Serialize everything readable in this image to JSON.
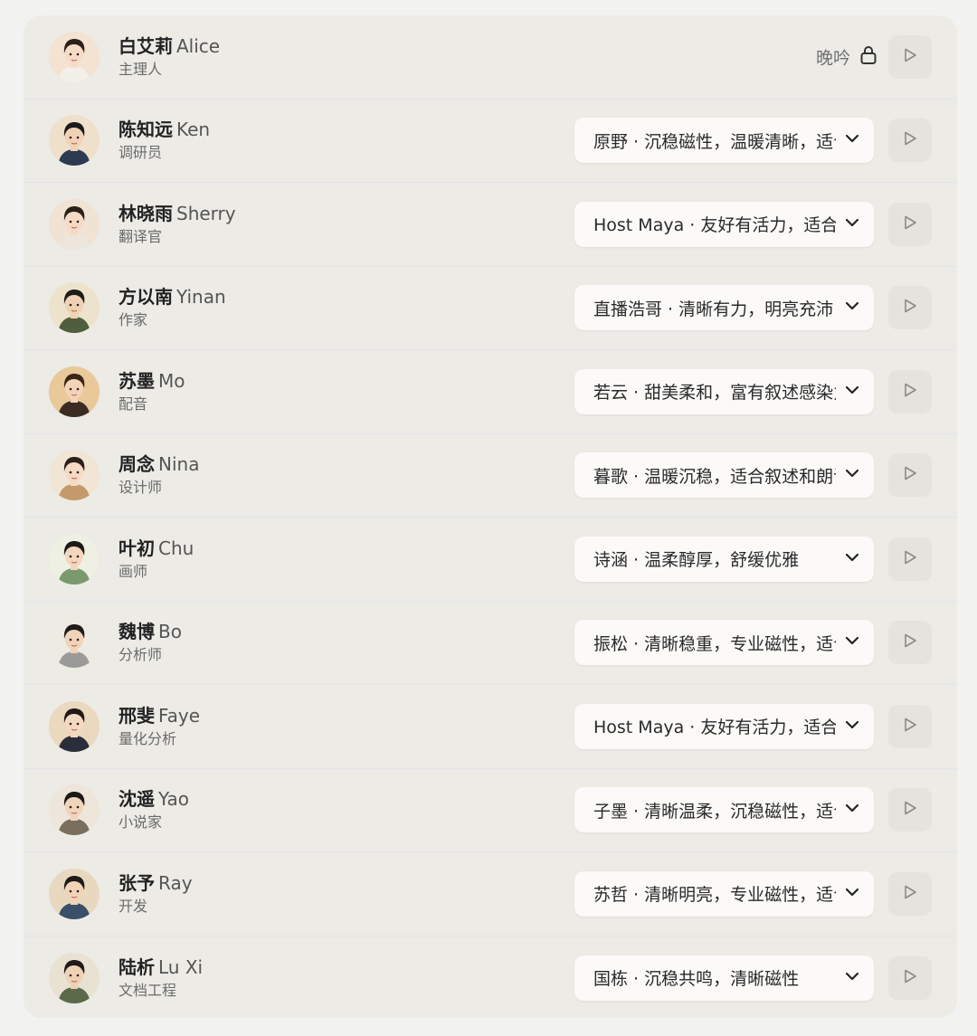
{
  "members": [
    {
      "name_zh": "白艾莉",
      "name_en": "Alice",
      "role": "主理人",
      "voice": "晚吟",
      "locked": true,
      "avatar": {
        "hair": "#2b211c",
        "skin": "#f6dcc6",
        "cloth": "#f3efe9",
        "bg": "#f4e2d2"
      }
    },
    {
      "name_zh": "陈知远",
      "name_en": "Ken",
      "role": "调研员",
      "voice": "原野 · 沉稳磁性，温暖清晰，适合",
      "locked": false,
      "avatar": {
        "hair": "#1c1a1a",
        "skin": "#f1d2b6",
        "cloth": "#2c3a52",
        "bg": "#efe0cc"
      }
    },
    {
      "name_zh": "林晓雨",
      "name_en": "Sherry",
      "role": "翻译官",
      "voice": "Host Maya · 友好有活力，适合",
      "locked": false,
      "avatar": {
        "hair": "#2a1f1a",
        "skin": "#f6dac6",
        "cloth": "#ece6dc",
        "bg": "#f1e3d4"
      }
    },
    {
      "name_zh": "方以南",
      "name_en": "Yinan",
      "role": "作家",
      "voice": "直播浩哥 · 清晰有力，明亮充沛",
      "locked": false,
      "avatar": {
        "hair": "#1e1c1a",
        "skin": "#efd1b4",
        "cloth": "#4f5e3c",
        "bg": "#ede2cc"
      }
    },
    {
      "name_zh": "苏墨",
      "name_en": "Mo",
      "role": "配音",
      "voice": "若云 · 甜美柔和，富有叙述感染力",
      "locked": false,
      "avatar": {
        "hair": "#3a2618",
        "skin": "#f3d4b8",
        "cloth": "#3b2b22",
        "bg": "#e9c89a"
      }
    },
    {
      "name_zh": "周念",
      "name_en": "Nina",
      "role": "设计师",
      "voice": "暮歌 · 温暖沉稳，适合叙述和朗读",
      "locked": false,
      "avatar": {
        "hair": "#2a1f1a",
        "skin": "#f5dac4",
        "cloth": "#c49a6c",
        "bg": "#f1e6d6"
      }
    },
    {
      "name_zh": "叶初",
      "name_en": "Chu",
      "role": "画师",
      "voice": "诗涵 · 温柔醇厚，舒缓优雅",
      "locked": false,
      "avatar": {
        "hair": "#1e1a18",
        "skin": "#f3d6bd",
        "cloth": "#7a9a6e",
        "bg": "#eef0e4"
      }
    },
    {
      "name_zh": "魏博",
      "name_en": "Bo",
      "role": "分析师",
      "voice": "振松 · 清晰稳重，专业磁性，适合",
      "locked": false,
      "avatar": {
        "hair": "#1f1c1a",
        "skin": "#f0d3b8",
        "cloth": "#9a9a98",
        "bg": "#eeeae4"
      }
    },
    {
      "name_zh": "邢斐",
      "name_en": "Faye",
      "role": "量化分析",
      "voice": "Host Maya · 友好有活力，适合",
      "locked": false,
      "avatar": {
        "hair": "#221a16",
        "skin": "#f4d8c2",
        "cloth": "#2a2e3a",
        "bg": "#ead8bf"
      }
    },
    {
      "name_zh": "沈遥",
      "name_en": "Yao",
      "role": "小说家",
      "voice": "子墨 · 清晰温柔，沉稳磁性，适合",
      "locked": false,
      "avatar": {
        "hair": "#1c1a18",
        "skin": "#f0d4bb",
        "cloth": "#7a6e5e",
        "bg": "#eee6da"
      }
    },
    {
      "name_zh": "张予",
      "name_en": "Ray",
      "role": "开发",
      "voice": "苏哲 · 清晰明亮，专业磁性，适合",
      "locked": false,
      "avatar": {
        "hair": "#1e1b19",
        "skin": "#f1d3b7",
        "cloth": "#3b4e6a",
        "bg": "#e8d8c0"
      }
    },
    {
      "name_zh": "陆析",
      "name_en": "Lu Xi",
      "role": "文档工程",
      "voice": "国栋 · 沉稳共鸣，清晰磁性",
      "locked": false,
      "avatar": {
        "hair": "#1e1b19",
        "skin": "#efd1b4",
        "cloth": "#5a6a4a",
        "bg": "#e9e2d2"
      }
    }
  ],
  "icons": {
    "lock": "lock-icon",
    "play": "play-icon",
    "chevron": "chevron-down-icon"
  },
  "colors": {
    "panel": "#ecebe6",
    "select_bg": "#fbfaf8",
    "play_bg": "#e5e3dd",
    "divider": "#e3e4ec"
  }
}
